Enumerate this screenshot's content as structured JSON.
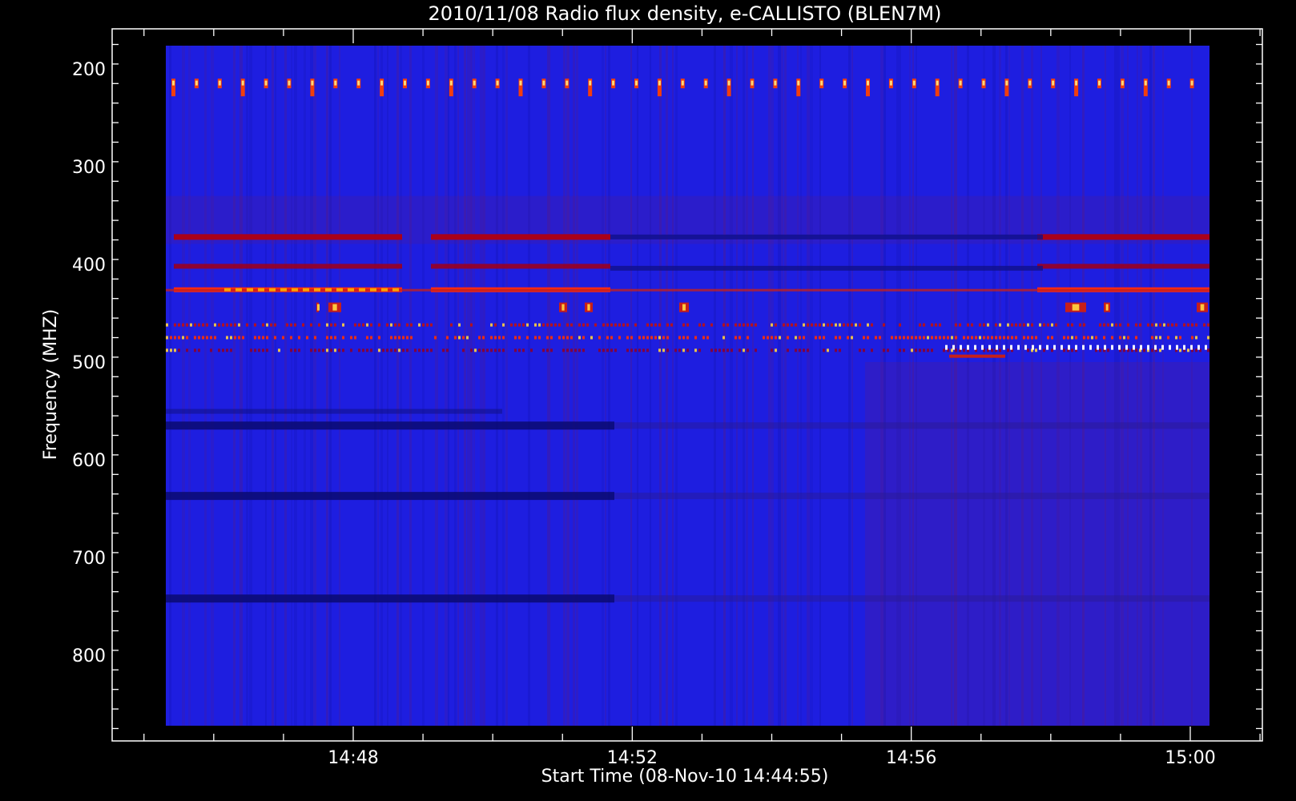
{
  "chart_data": {
    "type": "heatmap",
    "title": "2010/11/08  Radio flux density, e-CALLISTO (BLEN7M)",
    "xlabel": "Start Time (08-Nov-10 14:44:55)",
    "ylabel": "Frequency (MHZ)",
    "x_ticks": [
      "14:48",
      "14:52",
      "14:56",
      "15:00"
    ],
    "y_ticks": [
      200,
      300,
      400,
      500,
      600,
      700,
      800
    ],
    "xlim": [
      "14:44:55",
      "15:00:25"
    ],
    "ylim": [
      870,
      175
    ],
    "y_axis_inverted": true,
    "colormap": [
      "#0000cc",
      "#1a1aee",
      "#7a1040",
      "#d00000",
      "#ff3000",
      "#ffd040",
      "#ffffff"
    ],
    "background_color": "#1e1ee0",
    "strong_bands_mhz": [
      372,
      402,
      426,
      444,
      462,
      475,
      488
    ],
    "periodic_burst_band_mhz": 213,
    "dark_bands_mhz": [
      565,
      637,
      742
    ]
  }
}
